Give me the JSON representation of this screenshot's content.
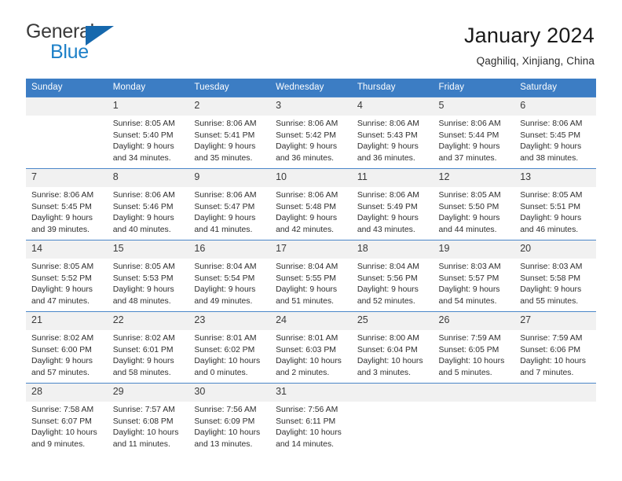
{
  "brand": {
    "name_part1": "General",
    "name_part2": "Blue",
    "accent_color": "#1d80c8",
    "triangle_color": "#1668ad"
  },
  "header": {
    "title": "January 2024",
    "subtitle": "Qaghiliq, Xinjiang, China"
  },
  "theme": {
    "header_blue": "#3c7dc4",
    "daynum_bg": "#f1f1f1",
    "row_border": "#4a86c8"
  },
  "weekday_headers": [
    "Sunday",
    "Monday",
    "Tuesday",
    "Wednesday",
    "Thursday",
    "Friday",
    "Saturday"
  ],
  "labels": {
    "sunrise": "Sunrise:",
    "sunset": "Sunset:",
    "daylight": "Daylight:"
  },
  "weeks": [
    [
      {
        "day": "",
        "sunrise": "",
        "sunset": "",
        "daylight1": "",
        "daylight2": ""
      },
      {
        "day": "1",
        "sunrise": "Sunrise: 8:05 AM",
        "sunset": "Sunset: 5:40 PM",
        "daylight1": "Daylight: 9 hours",
        "daylight2": "and 34 minutes."
      },
      {
        "day": "2",
        "sunrise": "Sunrise: 8:06 AM",
        "sunset": "Sunset: 5:41 PM",
        "daylight1": "Daylight: 9 hours",
        "daylight2": "and 35 minutes."
      },
      {
        "day": "3",
        "sunrise": "Sunrise: 8:06 AM",
        "sunset": "Sunset: 5:42 PM",
        "daylight1": "Daylight: 9 hours",
        "daylight2": "and 36 minutes."
      },
      {
        "day": "4",
        "sunrise": "Sunrise: 8:06 AM",
        "sunset": "Sunset: 5:43 PM",
        "daylight1": "Daylight: 9 hours",
        "daylight2": "and 36 minutes."
      },
      {
        "day": "5",
        "sunrise": "Sunrise: 8:06 AM",
        "sunset": "Sunset: 5:44 PM",
        "daylight1": "Daylight: 9 hours",
        "daylight2": "and 37 minutes."
      },
      {
        "day": "6",
        "sunrise": "Sunrise: 8:06 AM",
        "sunset": "Sunset: 5:45 PM",
        "daylight1": "Daylight: 9 hours",
        "daylight2": "and 38 minutes."
      }
    ],
    [
      {
        "day": "7",
        "sunrise": "Sunrise: 8:06 AM",
        "sunset": "Sunset: 5:45 PM",
        "daylight1": "Daylight: 9 hours",
        "daylight2": "and 39 minutes."
      },
      {
        "day": "8",
        "sunrise": "Sunrise: 8:06 AM",
        "sunset": "Sunset: 5:46 PM",
        "daylight1": "Daylight: 9 hours",
        "daylight2": "and 40 minutes."
      },
      {
        "day": "9",
        "sunrise": "Sunrise: 8:06 AM",
        "sunset": "Sunset: 5:47 PM",
        "daylight1": "Daylight: 9 hours",
        "daylight2": "and 41 minutes."
      },
      {
        "day": "10",
        "sunrise": "Sunrise: 8:06 AM",
        "sunset": "Sunset: 5:48 PM",
        "daylight1": "Daylight: 9 hours",
        "daylight2": "and 42 minutes."
      },
      {
        "day": "11",
        "sunrise": "Sunrise: 8:06 AM",
        "sunset": "Sunset: 5:49 PM",
        "daylight1": "Daylight: 9 hours",
        "daylight2": "and 43 minutes."
      },
      {
        "day": "12",
        "sunrise": "Sunrise: 8:05 AM",
        "sunset": "Sunset: 5:50 PM",
        "daylight1": "Daylight: 9 hours",
        "daylight2": "and 44 minutes."
      },
      {
        "day": "13",
        "sunrise": "Sunrise: 8:05 AM",
        "sunset": "Sunset: 5:51 PM",
        "daylight1": "Daylight: 9 hours",
        "daylight2": "and 46 minutes."
      }
    ],
    [
      {
        "day": "14",
        "sunrise": "Sunrise: 8:05 AM",
        "sunset": "Sunset: 5:52 PM",
        "daylight1": "Daylight: 9 hours",
        "daylight2": "and 47 minutes."
      },
      {
        "day": "15",
        "sunrise": "Sunrise: 8:05 AM",
        "sunset": "Sunset: 5:53 PM",
        "daylight1": "Daylight: 9 hours",
        "daylight2": "and 48 minutes."
      },
      {
        "day": "16",
        "sunrise": "Sunrise: 8:04 AM",
        "sunset": "Sunset: 5:54 PM",
        "daylight1": "Daylight: 9 hours",
        "daylight2": "and 49 minutes."
      },
      {
        "day": "17",
        "sunrise": "Sunrise: 8:04 AM",
        "sunset": "Sunset: 5:55 PM",
        "daylight1": "Daylight: 9 hours",
        "daylight2": "and 51 minutes."
      },
      {
        "day": "18",
        "sunrise": "Sunrise: 8:04 AM",
        "sunset": "Sunset: 5:56 PM",
        "daylight1": "Daylight: 9 hours",
        "daylight2": "and 52 minutes."
      },
      {
        "day": "19",
        "sunrise": "Sunrise: 8:03 AM",
        "sunset": "Sunset: 5:57 PM",
        "daylight1": "Daylight: 9 hours",
        "daylight2": "and 54 minutes."
      },
      {
        "day": "20",
        "sunrise": "Sunrise: 8:03 AM",
        "sunset": "Sunset: 5:58 PM",
        "daylight1": "Daylight: 9 hours",
        "daylight2": "and 55 minutes."
      }
    ],
    [
      {
        "day": "21",
        "sunrise": "Sunrise: 8:02 AM",
        "sunset": "Sunset: 6:00 PM",
        "daylight1": "Daylight: 9 hours",
        "daylight2": "and 57 minutes."
      },
      {
        "day": "22",
        "sunrise": "Sunrise: 8:02 AM",
        "sunset": "Sunset: 6:01 PM",
        "daylight1": "Daylight: 9 hours",
        "daylight2": "and 58 minutes."
      },
      {
        "day": "23",
        "sunrise": "Sunrise: 8:01 AM",
        "sunset": "Sunset: 6:02 PM",
        "daylight1": "Daylight: 10 hours",
        "daylight2": "and 0 minutes."
      },
      {
        "day": "24",
        "sunrise": "Sunrise: 8:01 AM",
        "sunset": "Sunset: 6:03 PM",
        "daylight1": "Daylight: 10 hours",
        "daylight2": "and 2 minutes."
      },
      {
        "day": "25",
        "sunrise": "Sunrise: 8:00 AM",
        "sunset": "Sunset: 6:04 PM",
        "daylight1": "Daylight: 10 hours",
        "daylight2": "and 3 minutes."
      },
      {
        "day": "26",
        "sunrise": "Sunrise: 7:59 AM",
        "sunset": "Sunset: 6:05 PM",
        "daylight1": "Daylight: 10 hours",
        "daylight2": "and 5 minutes."
      },
      {
        "day": "27",
        "sunrise": "Sunrise: 7:59 AM",
        "sunset": "Sunset: 6:06 PM",
        "daylight1": "Daylight: 10 hours",
        "daylight2": "and 7 minutes."
      }
    ],
    [
      {
        "day": "28",
        "sunrise": "Sunrise: 7:58 AM",
        "sunset": "Sunset: 6:07 PM",
        "daylight1": "Daylight: 10 hours",
        "daylight2": "and 9 minutes."
      },
      {
        "day": "29",
        "sunrise": "Sunrise: 7:57 AM",
        "sunset": "Sunset: 6:08 PM",
        "daylight1": "Daylight: 10 hours",
        "daylight2": "and 11 minutes."
      },
      {
        "day": "30",
        "sunrise": "Sunrise: 7:56 AM",
        "sunset": "Sunset: 6:09 PM",
        "daylight1": "Daylight: 10 hours",
        "daylight2": "and 13 minutes."
      },
      {
        "day": "31",
        "sunrise": "Sunrise: 7:56 AM",
        "sunset": "Sunset: 6:11 PM",
        "daylight1": "Daylight: 10 hours",
        "daylight2": "and 14 minutes."
      },
      {
        "day": "",
        "sunrise": "",
        "sunset": "",
        "daylight1": "",
        "daylight2": ""
      },
      {
        "day": "",
        "sunrise": "",
        "sunset": "",
        "daylight1": "",
        "daylight2": ""
      },
      {
        "day": "",
        "sunrise": "",
        "sunset": "",
        "daylight1": "",
        "daylight2": ""
      }
    ]
  ]
}
